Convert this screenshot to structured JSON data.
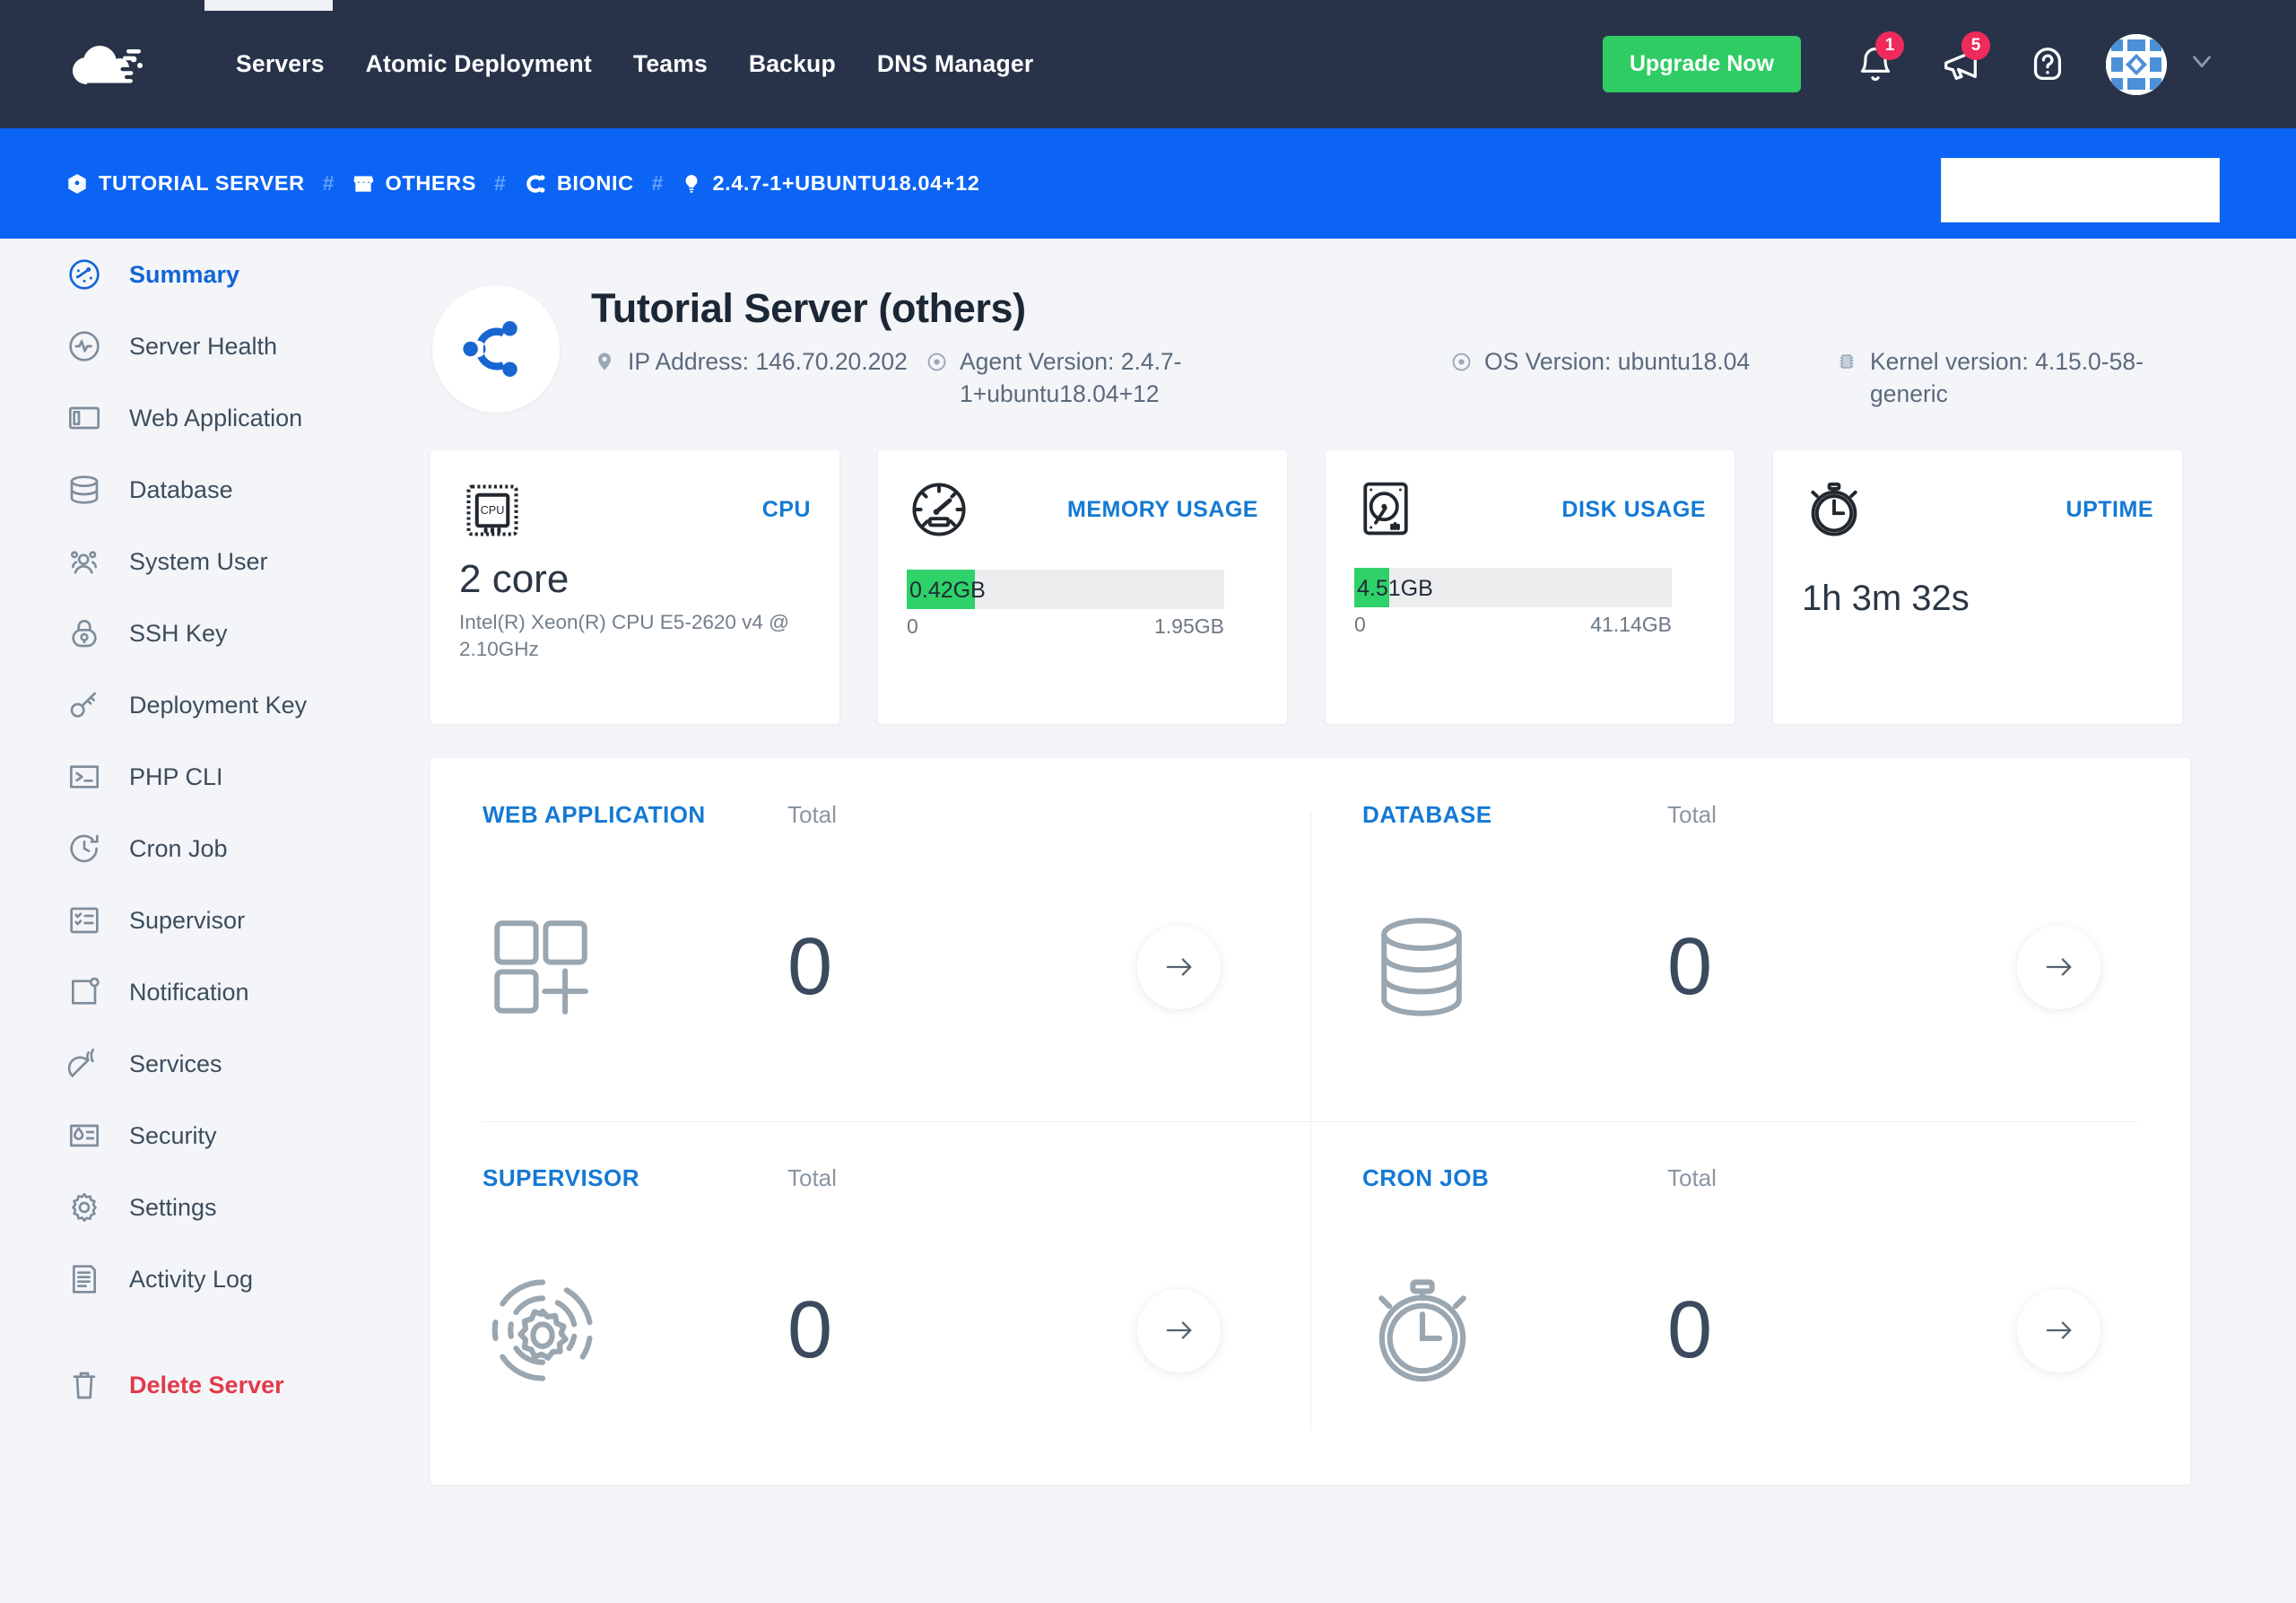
{
  "topnav": {
    "logo_icon": "cloudways-cloud-logo",
    "links": [
      {
        "label": "Servers"
      },
      {
        "label": "Atomic Deployment"
      },
      {
        "label": "Teams"
      },
      {
        "label": "Backup"
      },
      {
        "label": "DNS Manager"
      }
    ],
    "upgrade_label": "Upgrade Now",
    "upgrade_color": "#2ecc63",
    "bell_badge": "1",
    "megaphone_badge": "5",
    "badge_color": "#ef2b5b",
    "help_icon": "question-mark-icon",
    "avatar_icon": "user-avatar-identicon",
    "chevron": "⌄",
    "bg_color": "#28334a"
  },
  "breadcrumb": {
    "bg_color": "#0b64f4",
    "separator": "#",
    "items": [
      {
        "icon": "server-cube-icon",
        "label": "TUTORIAL SERVER"
      },
      {
        "icon": "storefront-icon",
        "label": "OTHERS"
      },
      {
        "icon": "ubuntu-icon",
        "label": "BIONIC"
      },
      {
        "icon": "agent-bulb-icon",
        "label": "2.4.7-1+UBUNTU18.04+12"
      }
    ]
  },
  "sidebar": {
    "items": [
      {
        "label": "Summary",
        "icon": "dashboard-gauge-icon",
        "active": true
      },
      {
        "label": "Server Health",
        "icon": "heartbeat-icon",
        "active": false
      },
      {
        "label": "Web Application",
        "icon": "layout-panel-icon",
        "active": false
      },
      {
        "label": "Database",
        "icon": "database-cylinder-icon",
        "active": false
      },
      {
        "label": "System User",
        "icon": "users-icon",
        "active": false
      },
      {
        "label": "SSH Key",
        "icon": "padlock-icon",
        "active": false
      },
      {
        "label": "Deployment Key",
        "icon": "key-icon",
        "active": false
      },
      {
        "label": "PHP CLI",
        "icon": "terminal-prompt-icon",
        "active": false
      },
      {
        "label": "Cron Job",
        "icon": "clock-refresh-icon",
        "active": false
      },
      {
        "label": "Supervisor",
        "icon": "checklist-icon",
        "active": false
      },
      {
        "label": "Notification",
        "icon": "notification-frame-icon",
        "active": false
      },
      {
        "label": "Services",
        "icon": "satellite-dish-icon",
        "active": false
      },
      {
        "label": "Security",
        "icon": "security-shield-grid-icon",
        "active": false
      },
      {
        "label": "Settings",
        "icon": "gear-icon",
        "active": false
      },
      {
        "label": "Activity Log",
        "icon": "document-lines-icon",
        "active": false
      }
    ],
    "delete": {
      "label": "Delete Server",
      "icon": "trash-icon",
      "color": "#e23a4a"
    }
  },
  "server": {
    "os_logo_icon": "ubuntu-logo",
    "title": "Tutorial Server (others)",
    "meta": [
      {
        "icon": "location-pin-icon",
        "text": "IP Address: 146.70.20.202"
      },
      {
        "icon": "target-circle-icon",
        "text": "Agent Version: 2.4.7-1+ubuntu18.04+12"
      },
      {
        "icon": "target-circle-icon",
        "text": "OS Version: ubuntu18.04"
      },
      {
        "icon": "cpu-chip-icon",
        "text": "Kernel version: 4.15.0-58-generic"
      }
    ]
  },
  "stats": {
    "cpu": {
      "label": "CPU",
      "icon": "cpu-chip-icon",
      "value": "2 core",
      "detail": "Intel(R) Xeon(R) CPU E5-2620 v4 @ 2.10GHz"
    },
    "memory": {
      "label": "MEMORY USAGE",
      "icon": "speedometer-icon",
      "used": "0.42GB",
      "min": "0",
      "max": "1.95GB",
      "percent": 21.5,
      "fill_color": "#2fd169"
    },
    "disk": {
      "label": "DISK USAGE",
      "icon": "hard-disk-icon",
      "used": "4.51GB",
      "used_prefix": "4.51",
      "used_suffix": "GB",
      "min": "0",
      "max": "41.14GB",
      "percent": 11.0,
      "fill_color": "#2fd169"
    },
    "uptime": {
      "label": "UPTIME",
      "icon": "stopwatch-icon",
      "value": "1h 3m 32s"
    }
  },
  "panels": [
    {
      "title": "WEB APPLICATION",
      "total_label": "Total",
      "count": "0",
      "icon": "app-grid-plus-icon",
      "arrow": "→"
    },
    {
      "title": "DATABASE",
      "total_label": "Total",
      "count": "0",
      "icon": "database-cylinder-icon",
      "arrow": "→"
    },
    {
      "title": "SUPERVISOR",
      "total_label": "Total",
      "count": "0",
      "icon": "gear-target-icon",
      "arrow": "→"
    },
    {
      "title": "CRON JOB",
      "total_label": "Total",
      "count": "0",
      "icon": "stopwatch-icon",
      "arrow": "→"
    }
  ]
}
